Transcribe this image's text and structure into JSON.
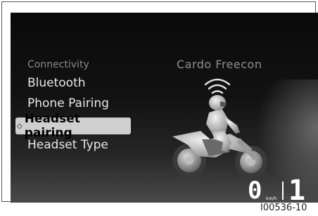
{
  "menu": {
    "header": "Connectivity",
    "items": [
      "Bluetooth",
      "Phone Pairing",
      "Headset pairing",
      "Headset Type"
    ],
    "selected_index": 2
  },
  "device": {
    "name": "Cardo Freecon"
  },
  "status": {
    "speed": "0",
    "speed_unit": "km/h",
    "gear": "1"
  },
  "figure_ref": "I00536-10",
  "colors": {
    "selection_bg": "#cfcfcf",
    "screen_bg": "#0a0a0a",
    "text": "#e8e8e8",
    "dim_text": "#8a8a8a"
  },
  "icons": [
    "wifi-signal-icon",
    "selected-diamond-icon",
    "motorcycle-rider-illustration"
  ]
}
